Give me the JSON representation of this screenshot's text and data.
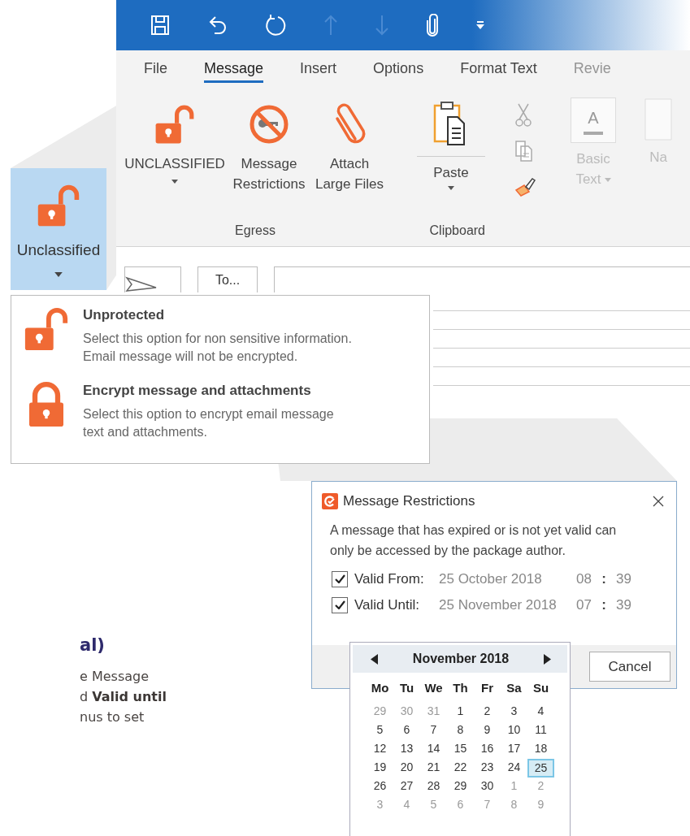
{
  "quick_access": [
    {
      "kind": "save",
      "disabled": false
    },
    {
      "kind": "undo",
      "disabled": false
    },
    {
      "kind": "redo",
      "disabled": false
    },
    {
      "kind": "up",
      "disabled": true
    },
    {
      "kind": "down",
      "disabled": true
    },
    {
      "kind": "attach",
      "disabled": false
    },
    {
      "kind": "customize",
      "disabled": false
    }
  ],
  "tabs": [
    {
      "label": "File",
      "selected": false,
      "disabled": false
    },
    {
      "label": "Message",
      "selected": true,
      "disabled": false
    },
    {
      "label": "Insert",
      "selected": false,
      "disabled": false
    },
    {
      "label": "Options",
      "selected": false,
      "disabled": false
    },
    {
      "label": "Format Text",
      "selected": false,
      "disabled": false
    },
    {
      "label": "Revie",
      "selected": false,
      "disabled": true
    }
  ],
  "egress_group": {
    "label": "Egress",
    "buttons": [
      {
        "kind": "unlock",
        "label": "UNCLASSIFIED",
        "dropdown": true
      },
      {
        "kind": "no-key",
        "label": "Message Restrictions",
        "dropdown": false
      },
      {
        "kind": "paperclip",
        "label": "Attach Large Files",
        "dropdown": false
      }
    ]
  },
  "clipboard_group": {
    "label": "Clipboard",
    "paste": {
      "label": "Paste",
      "dropdown": true
    },
    "small_buttons": [
      {
        "kind": "cut",
        "disabled": true
      },
      {
        "kind": "copy",
        "disabled": true
      },
      {
        "kind": "format-painter",
        "disabled": false
      }
    ]
  },
  "basic_text_group": {
    "buttons": [
      {
        "kind": "basic-text",
        "icon_text": "A",
        "label": "Basic Text",
        "dropdown": true,
        "disabled": true
      },
      {
        "kind": "names",
        "label": "Na",
        "dropdown": false,
        "disabled": true
      }
    ]
  },
  "compose": {
    "to_button": "To..."
  },
  "zoomed_button": {
    "label": "Unclassified",
    "dropdown": true
  },
  "classification_menu": [
    {
      "title": "Unprotected",
      "description": "Select this option for non sensitive information.\nEmail message will not be encrypted.",
      "locked": false
    },
    {
      "title": "Encrypt message and attachments",
      "description": "Select this option to encrypt email message\ntext and attachments.",
      "locked": true
    }
  ],
  "dialog": {
    "title": "Message Restrictions",
    "message": "A message that has expired or is not yet valid can\nonly be accessed by the package author.",
    "rows": [
      {
        "label": "Valid From:",
        "checked": true,
        "date": "25 October 2018",
        "hour": "08",
        "separator": ":",
        "minute": "39"
      },
      {
        "label": "Valid Until:",
        "checked": true,
        "date": "25 November 2018",
        "hour": "07",
        "separator": ":",
        "minute": "39"
      }
    ],
    "buttons": [
      "Cancel"
    ]
  },
  "calendar": {
    "title": "November 2018",
    "weekdays": [
      "Mo",
      "Tu",
      "We",
      "Th",
      "Fr",
      "Sa",
      "Su"
    ],
    "weeks": [
      [
        {
          "day": "29",
          "other_month": true,
          "selected": false
        },
        {
          "day": "30",
          "other_month": true,
          "selected": false
        },
        {
          "day": "31",
          "other_month": true,
          "selected": false
        },
        {
          "day": "1",
          "other_month": false,
          "selected": false
        },
        {
          "day": "2",
          "other_month": false,
          "selected": false
        },
        {
          "day": "3",
          "other_month": false,
          "selected": false
        },
        {
          "day": "4",
          "other_month": false,
          "selected": false
        }
      ],
      [
        {
          "day": "5",
          "other_month": false,
          "selected": false
        },
        {
          "day": "6",
          "other_month": false,
          "selected": false
        },
        {
          "day": "7",
          "other_month": false,
          "selected": false
        },
        {
          "day": "8",
          "other_month": false,
          "selected": false
        },
        {
          "day": "9",
          "other_month": false,
          "selected": false
        },
        {
          "day": "10",
          "other_month": false,
          "selected": false
        },
        {
          "day": "11",
          "other_month": false,
          "selected": false
        }
      ],
      [
        {
          "day": "12",
          "other_month": false,
          "selected": false
        },
        {
          "day": "13",
          "other_month": false,
          "selected": false
        },
        {
          "day": "14",
          "other_month": false,
          "selected": false
        },
        {
          "day": "15",
          "other_month": false,
          "selected": false
        },
        {
          "day": "16",
          "other_month": false,
          "selected": false
        },
        {
          "day": "17",
          "other_month": false,
          "selected": false
        },
        {
          "day": "18",
          "other_month": false,
          "selected": false
        }
      ],
      [
        {
          "day": "19",
          "other_month": false,
          "selected": false
        },
        {
          "day": "20",
          "other_month": false,
          "selected": false
        },
        {
          "day": "21",
          "other_month": false,
          "selected": false
        },
        {
          "day": "22",
          "other_month": false,
          "selected": false
        },
        {
          "day": "23",
          "other_month": false,
          "selected": false
        },
        {
          "day": "24",
          "other_month": false,
          "selected": false
        },
        {
          "day": "25",
          "other_month": false,
          "selected": true
        }
      ],
      [
        {
          "day": "26",
          "other_month": false,
          "selected": false
        },
        {
          "day": "27",
          "other_month": false,
          "selected": false
        },
        {
          "day": "28",
          "other_month": false,
          "selected": false
        },
        {
          "day": "29",
          "other_month": false,
          "selected": false
        },
        {
          "day": "30",
          "other_month": false,
          "selected": false
        },
        {
          "day": "1",
          "other_month": true,
          "selected": false
        },
        {
          "day": "2",
          "other_month": true,
          "selected": false
        }
      ],
      [
        {
          "day": "3",
          "other_month": true,
          "selected": false
        },
        {
          "day": "4",
          "other_month": true,
          "selected": false
        },
        {
          "day": "5",
          "other_month": true,
          "selected": false
        },
        {
          "day": "6",
          "other_month": true,
          "selected": false
        },
        {
          "day": "7",
          "other_month": true,
          "selected": false
        },
        {
          "day": "8",
          "other_month": true,
          "selected": false
        },
        {
          "day": "9",
          "other_month": true,
          "selected": false
        }
      ]
    ]
  },
  "fragment": {
    "heading": "al)",
    "lines": [
      "e Message",
      "d **Valid until**",
      "nus to set"
    ]
  }
}
